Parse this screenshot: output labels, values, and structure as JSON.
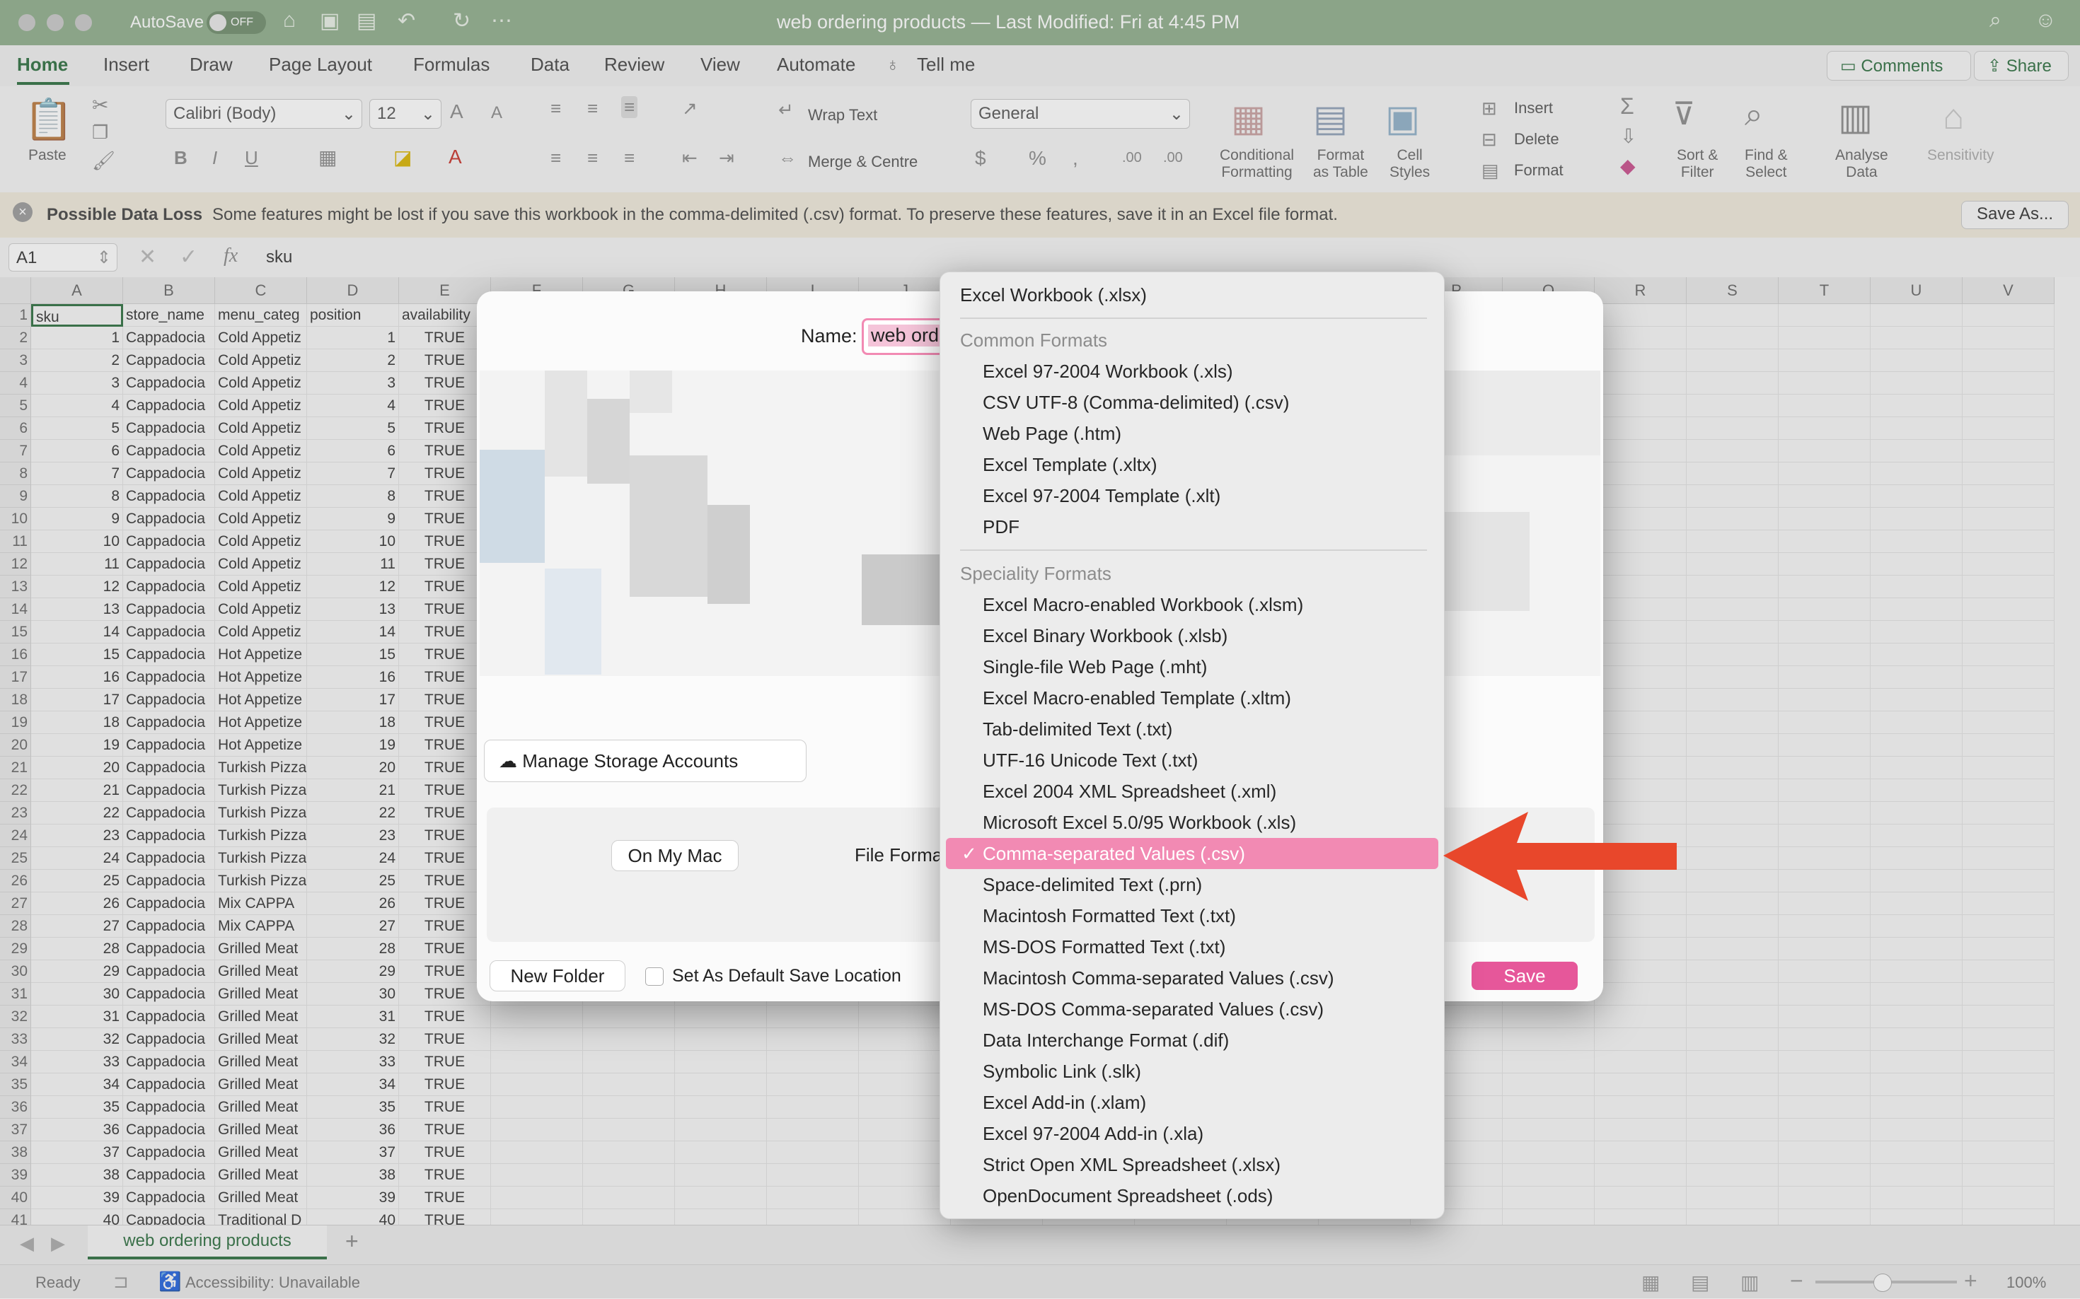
{
  "titlebar": {
    "autosave_label": "AutoSave",
    "autosave_state": "OFF",
    "title": "web ordering products — Last Modified: Fri at 4:45 PM",
    "icons": [
      "home-icon",
      "save-icon",
      "save-as-icon",
      "undo-icon",
      "redo-icon",
      "more-icon",
      "search-icon",
      "account-icon"
    ]
  },
  "tabs": [
    "Home",
    "Insert",
    "Draw",
    "Page Layout",
    "Formulas",
    "Data",
    "Review",
    "View",
    "Automate",
    "Tell me"
  ],
  "comments_label": "Comments",
  "share_label": "Share",
  "ribbon": {
    "paste": "Paste",
    "font_name": "Calibri (Body)",
    "font_size": "12",
    "wrap_text": "Wrap Text",
    "merge_center": "Merge & Centre",
    "number_format": "General",
    "conditional_formatting": "Conditional\nFormatting",
    "format_as_table": "Format\nas Table",
    "cell_styles": "Cell\nStyles",
    "insert": "Insert",
    "delete": "Delete",
    "format": "Format",
    "sort_filter": "Sort &\nFilter",
    "find_select": "Find &\nSelect",
    "analyse_data": "Analyse\nData",
    "sensitivity": "Sensitivity"
  },
  "message_bar": {
    "title": "Possible Data Loss",
    "text": "Some features might be lost if you save this workbook in the comma-delimited (.csv) format. To preserve these features, save it in an Excel file format.",
    "button": "Save As..."
  },
  "formula_bar": {
    "cell_ref": "A1",
    "fx": "fx",
    "value": "sku"
  },
  "grid": {
    "columns": [
      "A",
      "B",
      "C",
      "D",
      "E",
      "F",
      "G",
      "H",
      "I",
      "J",
      "K",
      "L",
      "M",
      "N",
      "O",
      "P",
      "Q",
      "R",
      "S",
      "T",
      "U",
      "V"
    ],
    "header_row": [
      "sku",
      "store_name",
      "menu_categ",
      "position",
      "availability"
    ],
    "rows": [
      [
        "1",
        "Cappadocia",
        "Cold Appetiz",
        "1",
        "TRUE"
      ],
      [
        "2",
        "Cappadocia",
        "Cold Appetiz",
        "2",
        "TRUE"
      ],
      [
        "3",
        "Cappadocia",
        "Cold Appetiz",
        "3",
        "TRUE"
      ],
      [
        "4",
        "Cappadocia",
        "Cold Appetiz",
        "4",
        "TRUE"
      ],
      [
        "5",
        "Cappadocia",
        "Cold Appetiz",
        "5",
        "TRUE"
      ],
      [
        "6",
        "Cappadocia",
        "Cold Appetiz",
        "6",
        "TRUE"
      ],
      [
        "7",
        "Cappadocia",
        "Cold Appetiz",
        "7",
        "TRUE"
      ],
      [
        "8",
        "Cappadocia",
        "Cold Appetiz",
        "8",
        "TRUE"
      ],
      [
        "9",
        "Cappadocia",
        "Cold Appetiz",
        "9",
        "TRUE"
      ],
      [
        "10",
        "Cappadocia",
        "Cold Appetiz",
        "10",
        "TRUE"
      ],
      [
        "11",
        "Cappadocia",
        "Cold Appetiz",
        "11",
        "TRUE"
      ],
      [
        "12",
        "Cappadocia",
        "Cold Appetiz",
        "12",
        "TRUE"
      ],
      [
        "13",
        "Cappadocia",
        "Cold Appetiz",
        "13",
        "TRUE"
      ],
      [
        "14",
        "Cappadocia",
        "Cold Appetiz",
        "14",
        "TRUE"
      ],
      [
        "15",
        "Cappadocia",
        "Hot Appetize",
        "15",
        "TRUE"
      ],
      [
        "16",
        "Cappadocia",
        "Hot Appetize",
        "16",
        "TRUE"
      ],
      [
        "17",
        "Cappadocia",
        "Hot Appetize",
        "17",
        "TRUE"
      ],
      [
        "18",
        "Cappadocia",
        "Hot Appetize",
        "18",
        "TRUE"
      ],
      [
        "19",
        "Cappadocia",
        "Hot Appetize",
        "19",
        "TRUE"
      ],
      [
        "20",
        "Cappadocia",
        "Turkish Pizza",
        "20",
        "TRUE"
      ],
      [
        "21",
        "Cappadocia",
        "Turkish Pizza",
        "21",
        "TRUE"
      ],
      [
        "22",
        "Cappadocia",
        "Turkish Pizza",
        "22",
        "TRUE"
      ],
      [
        "23",
        "Cappadocia",
        "Turkish Pizza",
        "23",
        "TRUE"
      ],
      [
        "24",
        "Cappadocia",
        "Turkish Pizza",
        "24",
        "TRUE"
      ],
      [
        "25",
        "Cappadocia",
        "Turkish Pizza",
        "25",
        "TRUE"
      ],
      [
        "26",
        "Cappadocia",
        "Mix CAPPA",
        "26",
        "TRUE"
      ],
      [
        "27",
        "Cappadocia",
        "Mix CAPPA",
        "27",
        "TRUE"
      ],
      [
        "28",
        "Cappadocia",
        "Grilled Meat",
        "28",
        "TRUE"
      ],
      [
        "29",
        "Cappadocia",
        "Grilled Meat",
        "29",
        "TRUE"
      ],
      [
        "30",
        "Cappadocia",
        "Grilled Meat",
        "30",
        "TRUE"
      ],
      [
        "31",
        "Cappadocia",
        "Grilled Meat",
        "31",
        "TRUE"
      ],
      [
        "32",
        "Cappadocia",
        "Grilled Meat",
        "32",
        "TRUE"
      ],
      [
        "33",
        "Cappadocia",
        "Grilled Meat",
        "33",
        "TRUE"
      ],
      [
        "34",
        "Cappadocia",
        "Grilled Meat",
        "34",
        "TRUE"
      ],
      [
        "35",
        "Cappadocia",
        "Grilled Meat",
        "35",
        "TRUE"
      ],
      [
        "36",
        "Cappadocia",
        "Grilled Meat",
        "36",
        "TRUE"
      ],
      [
        "37",
        "Cappadocia",
        "Grilled Meat",
        "37",
        "TRUE"
      ],
      [
        "38",
        "Cappadocia",
        "Grilled Meat",
        "38",
        "TRUE"
      ],
      [
        "39",
        "Cappadocia",
        "Grilled Meat",
        "39",
        "TRUE"
      ],
      [
        "40",
        "Cappadocia",
        "Traditional D",
        "40",
        "TRUE"
      ]
    ]
  },
  "dialog": {
    "name_label": "Name:",
    "name_value": "web ordering products",
    "manage_storage": "Manage Storage Accounts",
    "on_my_mac": "On My Mac",
    "file_format_label": "File Format:",
    "new_folder": "New Folder",
    "default_location": "Set As Default Save Location",
    "save": "Save"
  },
  "format_menu": {
    "top_item": "Excel Workbook (.xlsx)",
    "common_header": "Common Formats",
    "common_items": [
      "Excel 97-2004 Workbook (.xls)",
      "CSV UTF-8 (Comma-delimited) (.csv)",
      "Web Page (.htm)",
      "Excel Template (.xltx)",
      "Excel 97-2004 Template (.xlt)",
      "PDF"
    ],
    "speciality_header": "Speciality Formats",
    "speciality_items": [
      "Excel Macro-enabled Workbook (.xlsm)",
      "Excel Binary Workbook (.xlsb)",
      "Single-file Web Page (.mht)",
      "Excel Macro-enabled Template (.xltm)",
      "Tab-delimited Text (.txt)",
      "UTF-16 Unicode Text (.txt)",
      "Excel 2004 XML Spreadsheet (.xml)",
      "Microsoft Excel 5.0/95 Workbook (.xls)",
      "Comma-separated Values (.csv)",
      "Space-delimited Text (.prn)",
      "Macintosh Formatted Text (.txt)",
      "MS-DOS Formatted Text (.txt)",
      "Macintosh Comma-separated Values (.csv)",
      "MS-DOS Comma-separated Values (.csv)",
      "Data Interchange Format (.dif)",
      "Symbolic Link (.slk)",
      "Excel Add-in (.xlam)",
      "Excel 97-2004 Add-in (.xla)",
      "Strict Open XML Spreadsheet (.xlsx)",
      "OpenDocument Spreadsheet (.ods)"
    ],
    "selected": "Comma-separated Values (.csv)",
    "check": "✓"
  },
  "sheet_tab": "web ordering products",
  "status": {
    "ready": "Ready",
    "accessibility": "Accessibility: Unavailable",
    "zoom": "100%"
  },
  "colors": {
    "titlebar": "#8fae8b",
    "accent": "#2c6e3f",
    "highlight": "#f28ab3",
    "save_button": "#e6579a",
    "arrow": "#e8472b"
  }
}
